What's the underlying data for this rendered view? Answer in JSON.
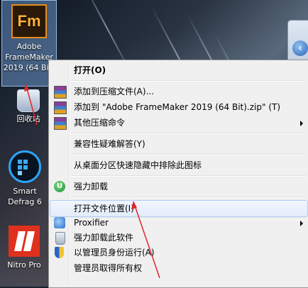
{
  "desktop": {
    "icons": [
      {
        "name": "framemaker",
        "label": "Adobe FrameMaker 2019 (64 Bit)",
        "logo_text": "Fm"
      },
      {
        "name": "recycle-bin",
        "label": "回收站"
      },
      {
        "name": "smart-defrag",
        "label": "Smart Defrag 6"
      },
      {
        "name": "nitro",
        "label": "Nitro Pro"
      }
    ]
  },
  "menu": {
    "items": [
      {
        "label": "打开(O)"
      },
      {
        "label": "添加到压缩文件(A)..."
      },
      {
        "label": "添加到 \"Adobe FrameMaker 2019 (64 Bit).zip\" (T)"
      },
      {
        "label": "其他压缩命令"
      },
      {
        "label": "兼容性疑难解答(Y)"
      },
      {
        "label": "从桌面分区快速隐藏中排除此图标"
      },
      {
        "label": "强力卸载"
      },
      {
        "label": "打开文件位置(I)"
      },
      {
        "label": "Proxifier"
      },
      {
        "label": "强力卸载此软件"
      },
      {
        "label": "以管理员身份运行(A)"
      },
      {
        "label": "管理员取得所有权"
      }
    ]
  },
  "colors": {
    "menu_bg": "#f0f0f0",
    "hover_border": "#aecdf2",
    "annotation_arrow": "#e0262b"
  }
}
